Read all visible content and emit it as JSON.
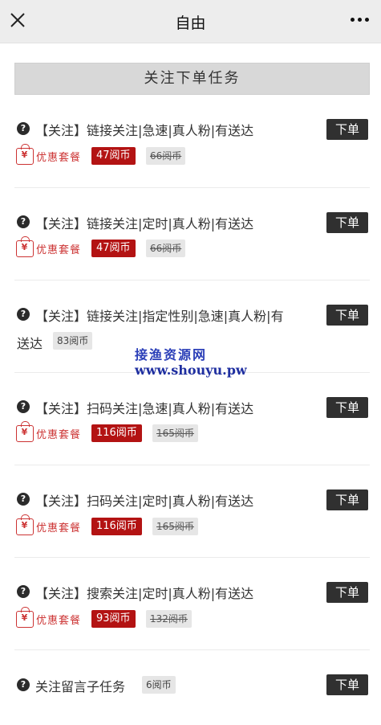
{
  "header": {
    "title": "自由",
    "close_icon": "close-icon",
    "more_icon": "more-icon"
  },
  "section": {
    "title": "关注下单任务"
  },
  "order_label": "下单",
  "promo_label": "优惠套餐",
  "watermark": {
    "line1": "接渔资源网",
    "line2": "www.shouyu.pw"
  },
  "items": [
    {
      "line1": "【关注】链接关注|急速|真人粉|有送达",
      "price": "47阅币",
      "original_price": "66阅币"
    },
    {
      "line1": "【关注】链接关注|定时|真人粉|有送达",
      "price": "47阅币",
      "original_price": "66阅币"
    },
    {
      "line1": "【关注】链接关注|指定性别|急速|真人粉|有",
      "line2": "送达",
      "price": "83阅币"
    },
    {
      "line1": "【关注】扫码关注|急速|真人粉|有送达",
      "price": "116阅币",
      "original_price": "165阅币"
    },
    {
      "line1": "【关注】扫码关注|定时|真人粉|有送达",
      "price": "116阅币",
      "original_price": "165阅币"
    },
    {
      "line1": "【关注】搜索关注|定时|真人粉|有送达",
      "price": "93阅币",
      "original_price": "132阅币"
    },
    {
      "line1": "关注留言子任务",
      "price": "6阅币"
    }
  ]
}
